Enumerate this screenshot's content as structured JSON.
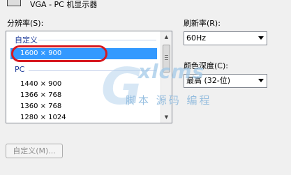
{
  "monitor": {
    "title": "VGA - PC 机显示器",
    "icon": "monitor-icon"
  },
  "resolution": {
    "label": "分辨率(S):",
    "groups": [
      {
        "name": "自定义",
        "items": [
          "1600 × 900"
        ]
      },
      {
        "name": "PC",
        "items": [
          "1440 × 900",
          "1366 × 768",
          "1360 × 768",
          "1280 × 1024"
        ]
      }
    ],
    "selected": "1600 × 900"
  },
  "refresh_rate": {
    "label": "刷新率(R):",
    "value": "60Hz"
  },
  "color_depth": {
    "label": "颜色深度(C):",
    "value": "最高 (32-位)"
  },
  "custom_button": {
    "label": "自定义(M)..."
  },
  "watermark": {
    "logo_text": "Gxlcms",
    "subtext": "脚本 源码 编程"
  },
  "colors": {
    "selection": "#3399ff",
    "highlight_oval": "#d71920",
    "group_header": "#1e3c9a"
  }
}
